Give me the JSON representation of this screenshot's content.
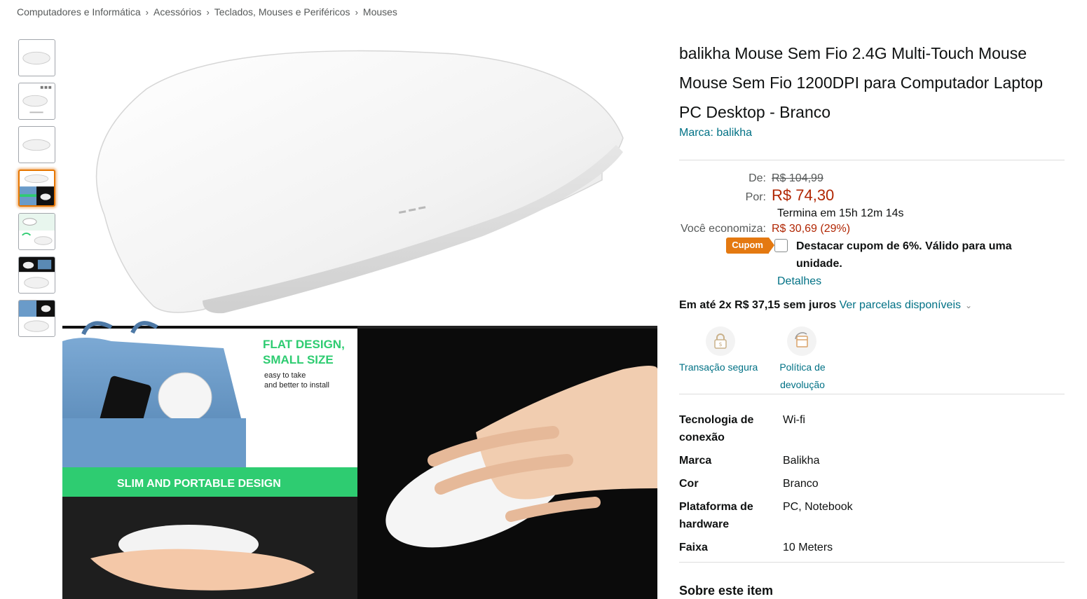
{
  "breadcrumb": [
    "Computadores e Informática",
    "Acessórios",
    "Teclados, Mouses e Periféricos",
    "Mouses"
  ],
  "breadcrumb_separator": "›",
  "product": {
    "title_lines": [
      "balikha Mouse Sem Fio 2.4G Multi-Touch Mouse",
      "Mouse Sem Fio 1200DPI para Computador Laptop",
      "PC Desktop - Branco"
    ],
    "brand_link": "Marca: balikha"
  },
  "price": {
    "de_label": "De:",
    "de_value": "R$ 104,99",
    "por_label": "Por:",
    "por_value": "R$ 74,30",
    "ends": "Termina em 15h 12m 14s",
    "save_label": "Você economiza:",
    "save_value": "R$ 30,69 (29%)"
  },
  "coupon": {
    "badge": "Cupom",
    "text": "Destacar cupom de 6%. Válido para uma unidade.",
    "details": "Detalhes",
    "checked": false
  },
  "installments": {
    "text": "Em até 2x R$ 37,15 sem juros",
    "link": "Ver parcelas disponíveis"
  },
  "trust_badges": [
    {
      "label": "Transação segura",
      "icon": "lock-icon"
    },
    {
      "label": "Política de devolução",
      "icon": "return-icon"
    }
  ],
  "specs": [
    {
      "key": "Tecnologia de conexão",
      "value": "Wi-fi"
    },
    {
      "key": "Marca",
      "value": "Balikha"
    },
    {
      "key": "Cor",
      "value": "Branco"
    },
    {
      "key": "Plataforma de hardware",
      "value": "PC, Notebook"
    },
    {
      "key": "Faixa",
      "value": "10 Meters"
    }
  ],
  "about_heading": "Sobre este item",
  "image": {
    "banner_top_line1": "FLAT DESIGN,",
    "banner_top_line2": "SMALL SIZE",
    "banner_sub_line1": "easy to take",
    "banner_sub_line2": "and better to install",
    "banner_strip": "SLIM AND PORTABLE DESIGN"
  },
  "colors": {
    "link": "#007185",
    "price": "#B12704",
    "coupon": "#E47911",
    "active_thumb": "#E77600",
    "banner_green": "#2ECC71"
  },
  "thumbnails_count": 7,
  "active_thumbnail": 4
}
